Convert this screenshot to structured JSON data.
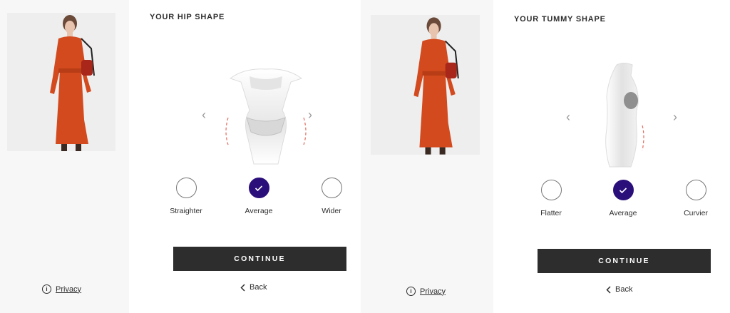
{
  "screens": [
    {
      "title": "YOUR HIP SHAPE",
      "options": [
        {
          "label": "Straighter",
          "selected": false
        },
        {
          "label": "Average",
          "selected": true
        },
        {
          "label": "Wider",
          "selected": false
        }
      ],
      "continue_label": "CONTINUE",
      "back_label": "Back",
      "privacy_label": "Privacy",
      "figure_icon": "front-body-figure",
      "prev_icon": "chevron-left",
      "next_icon": "chevron-right"
    },
    {
      "title": "YOUR TUMMY SHAPE",
      "options": [
        {
          "label": "Flatter",
          "selected": false
        },
        {
          "label": "Average",
          "selected": true
        },
        {
          "label": "Curvier",
          "selected": false
        }
      ],
      "continue_label": "CONTINUE",
      "back_label": "Back",
      "privacy_label": "Privacy",
      "figure_icon": "side-body-figure",
      "prev_icon": "chevron-left",
      "next_icon": "chevron-right"
    }
  ],
  "colors": {
    "selected": "#2a0f7a",
    "button": "#2d2d2d",
    "dress": "#d24a1e",
    "guide_lines": "#e06a5a"
  }
}
